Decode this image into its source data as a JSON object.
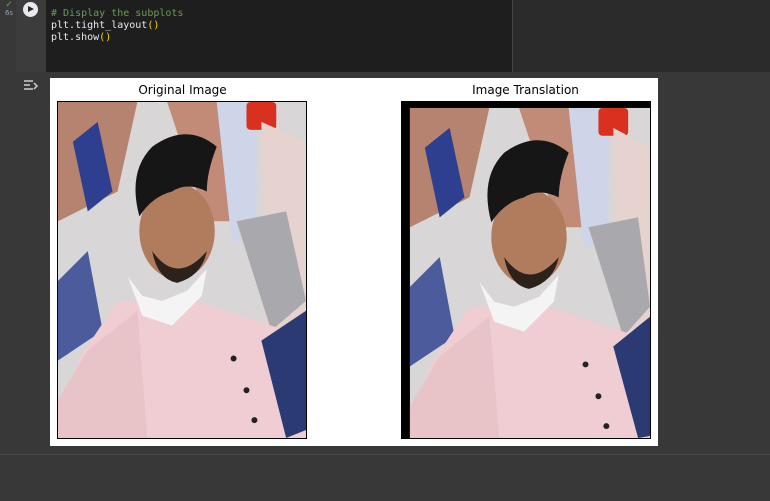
{
  "cell": {
    "exec_count": "6s",
    "status_icon": "check-icon",
    "run_icon": "play-icon",
    "code": {
      "line1": "# Display the subplots",
      "line2_name": "plt.tight_layout",
      "line2_parens": "()",
      "line3_name": "plt.show",
      "line3_parens": "()"
    }
  },
  "output": {
    "toggle_icon": "output-toggle-icon",
    "figure": {
      "subplots": [
        {
          "title": "Original Image"
        },
        {
          "title": "Image Translation"
        }
      ]
    }
  },
  "colors": {
    "background": "#383838",
    "editor": "#1e1e1e",
    "comment": "#6a9955",
    "paren": "#ffd700",
    "check": "#4caf50"
  }
}
